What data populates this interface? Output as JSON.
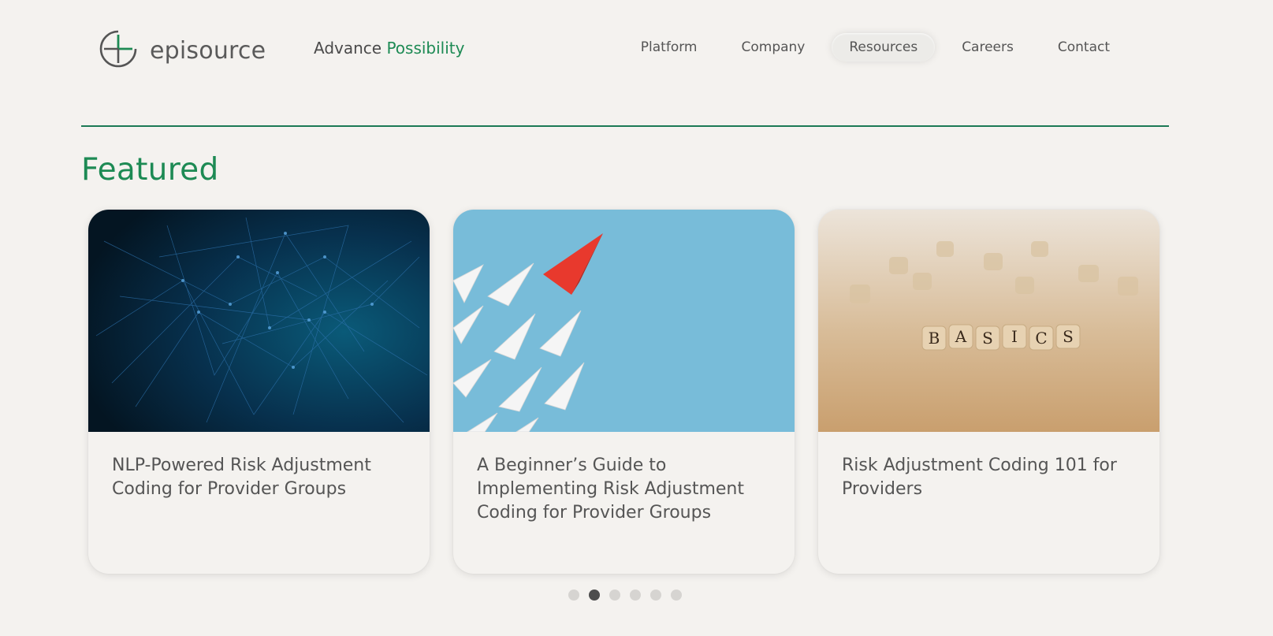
{
  "header": {
    "logo_text": "episource",
    "tagline_prefix": "Advance",
    "tagline_accent": "Possibility",
    "nav": [
      {
        "label": "Platform",
        "active": false
      },
      {
        "label": "Company",
        "active": false
      },
      {
        "label": "Resources",
        "active": true
      },
      {
        "label": "Careers",
        "active": false
      },
      {
        "label": "Contact",
        "active": false
      }
    ]
  },
  "colors": {
    "accent": "#1d8a54",
    "divider": "#1c7a55",
    "background": "#f4f2ef"
  },
  "featured": {
    "title": "Featured",
    "cards": [
      {
        "title": "NLP-Powered Risk Adjustment Coding for Provider Groups",
        "image": "data-network-image"
      },
      {
        "title": "A Beginner’s Guide to Implementing Risk Adjustment Coding for Provider Groups",
        "image": "paper-planes-image"
      },
      {
        "title": "Risk Adjustment Coding 101 for Providers",
        "image": "basics-blocks-image"
      }
    ],
    "basics_word": "BASICS",
    "pagination": {
      "total": 6,
      "active_index": 1
    }
  }
}
